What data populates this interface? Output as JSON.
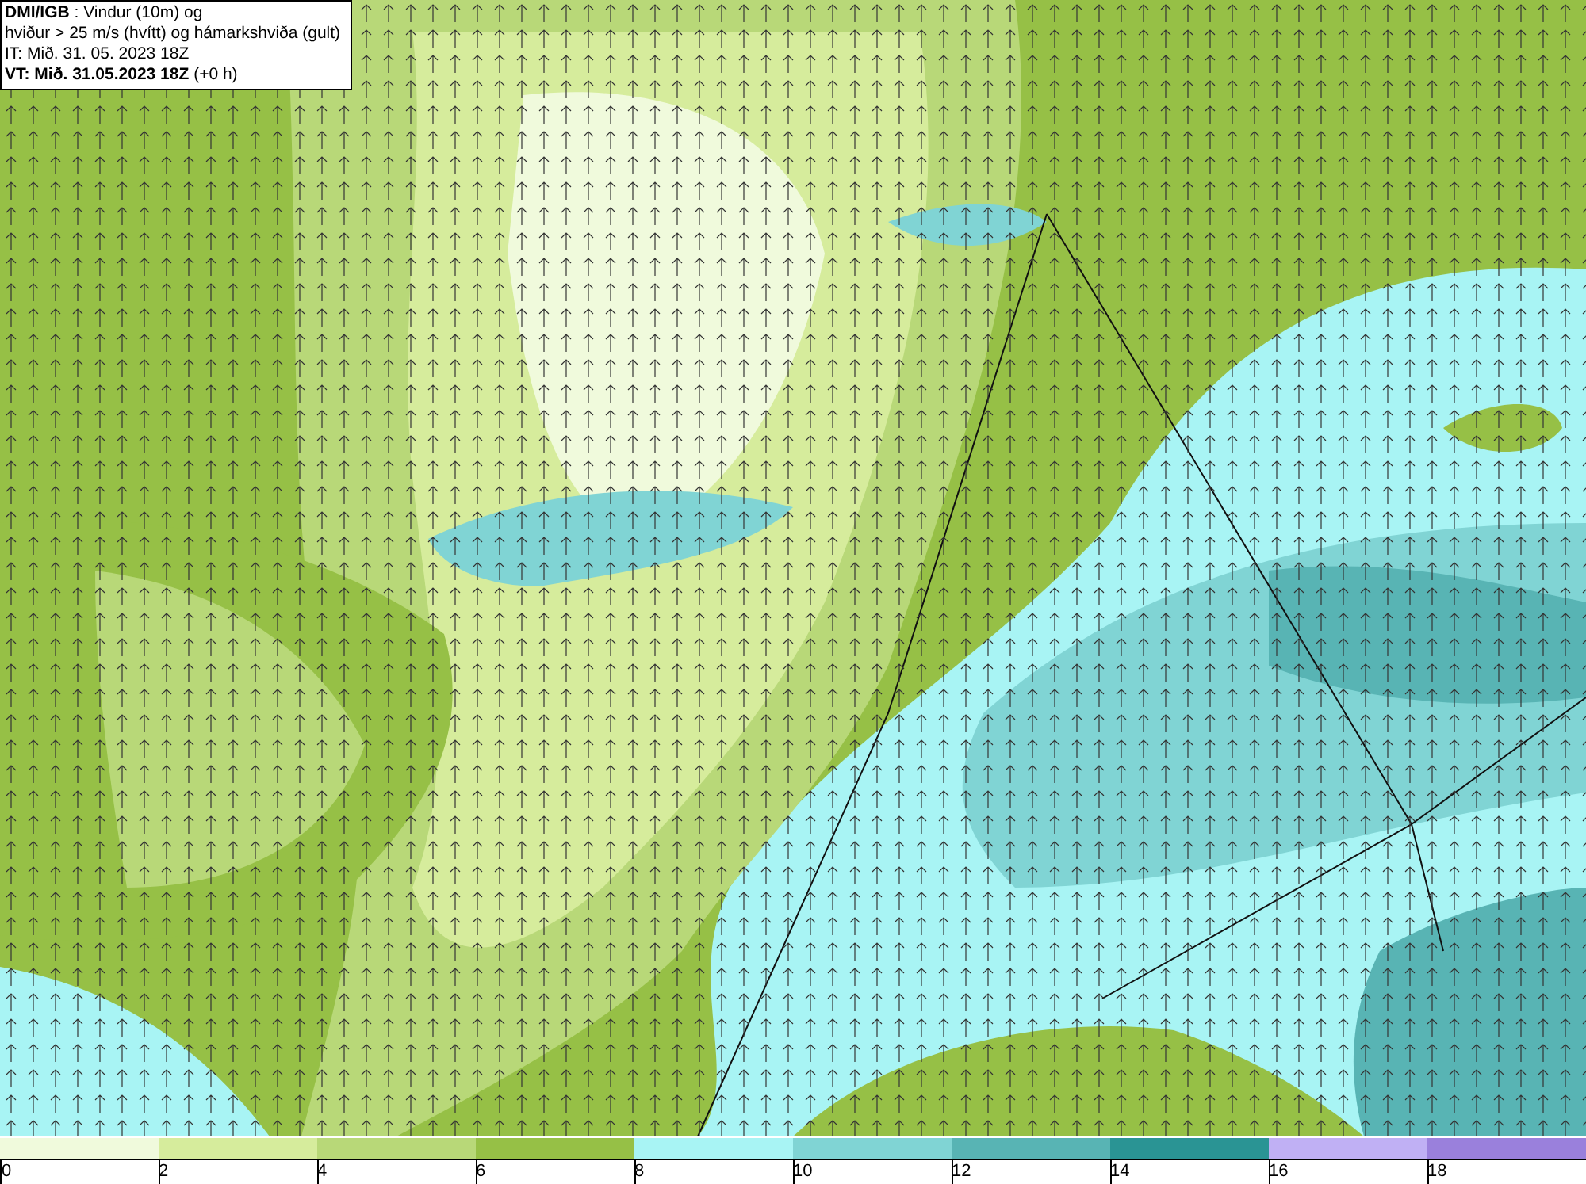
{
  "legend": {
    "lines": [
      "**DMI/IGB** : Vindur (10m) og",
      "hviður > 25 m/s (hvítt) og hámarkshviða (gult)",
      "IT: Mið. 31. 05. 2023 18Z",
      "**VT: Mið. 31.05.2023 18Z** (+0 h)"
    ]
  },
  "colorbar": {
    "segments": [
      {
        "color": "#f0fadc"
      },
      {
        "color": "#d6ec9c"
      },
      {
        "color": "#b8d878"
      },
      {
        "color": "#96c046"
      },
      {
        "color": "#a8f4f4"
      },
      {
        "color": "#80d4d4"
      },
      {
        "color": "#58b4b4"
      },
      {
        "color": "#2a9494"
      },
      {
        "color": "#c0b0f4"
      },
      {
        "color": "#9a80dc"
      }
    ],
    "ticks": [
      "0",
      "2",
      "4",
      "6",
      "8",
      "10",
      "12",
      "14",
      "16",
      "18"
    ]
  }
}
